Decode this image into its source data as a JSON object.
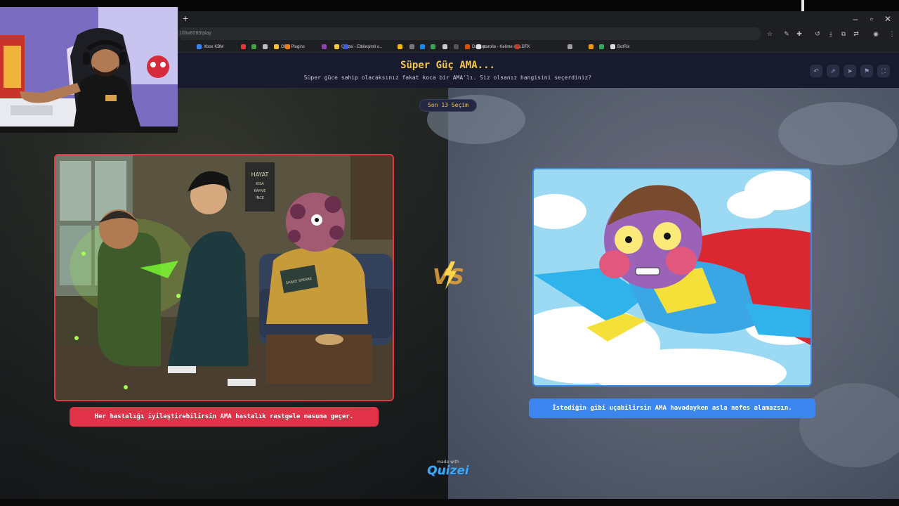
{
  "browser": {
    "new_tab_glyph": "+",
    "url_text": "10ba8283/play",
    "window_controls": [
      "–",
      "▫",
      "✕"
    ],
    "bookmarks": [
      {
        "label": "Xbox KBM",
        "color": "#3b82f6"
      },
      {
        "label": "",
        "color": "#e53935"
      },
      {
        "label": "",
        "color": "#43a047"
      },
      {
        "label": "",
        "color": "#bdbdbd"
      },
      {
        "label": "OBS Plugins",
        "color": "#f0c040"
      },
      {
        "label": "",
        "color": "#e67e22"
      },
      {
        "label": "",
        "color": "#8e44ad"
      },
      {
        "label": "Quizei - Etkileşimli v...",
        "color": "#f5c84b"
      },
      {
        "label": "",
        "color": "#3b5bdb"
      },
      {
        "label": "",
        "color": "#f0b90b"
      },
      {
        "label": "",
        "color": "#7a7a7a"
      },
      {
        "label": "",
        "color": "#1e88e5"
      },
      {
        "label": "",
        "color": "#34a853"
      },
      {
        "label": "",
        "color": "#cccccc"
      },
      {
        "label": "",
        "color": "#555555"
      },
      {
        "label": "DaFont",
        "color": "#d35400"
      },
      {
        "label": "parolla - Kelime oyu...",
        "color": "#e0e0e0"
      },
      {
        "label": "BTK",
        "color": "#c0392b"
      },
      {
        "label": "",
        "color": "#9e9e9e"
      },
      {
        "label": "",
        "color": "#f39c12"
      },
      {
        "label": "",
        "color": "#27ae60"
      },
      {
        "label": "BotRix",
        "color": "#dddddd"
      }
    ]
  },
  "header": {
    "title": "Süper Güç AMA...",
    "subtitle": "Süper güce sahip olacaksınız fakat koca bir AMA'lı. Siz olsanız hangisini seçerdiniz?",
    "buttons": [
      {
        "icon": "undo-icon",
        "glyph": "↶"
      },
      {
        "icon": "share-icon",
        "glyph": "⇗"
      },
      {
        "icon": "send-icon",
        "glyph": "➤"
      },
      {
        "icon": "flag-icon",
        "glyph": "⚑"
      },
      {
        "icon": "fullscreen-icon",
        "glyph": "⛶"
      }
    ]
  },
  "counter": {
    "label": "Son 13 Seçim"
  },
  "options": {
    "left": {
      "caption": "Her hastalığı iyileştirebilirsin AMA hastalık rastgele masuma geçer.",
      "color": "#e53546",
      "poster_text": [
        "HAYAT",
        "KISA",
        "KAHVE",
        "İNCE"
      ],
      "book_text": "SHAKE SPEARE"
    },
    "right": {
      "caption": "İstediğin gibi uçabilirsin AMA havadayken asla nefes alamazsın.",
      "color": "#3d8cf0"
    }
  },
  "vs_label": "VS",
  "footer": {
    "made_with": "made with",
    "brand": "Quizei"
  }
}
